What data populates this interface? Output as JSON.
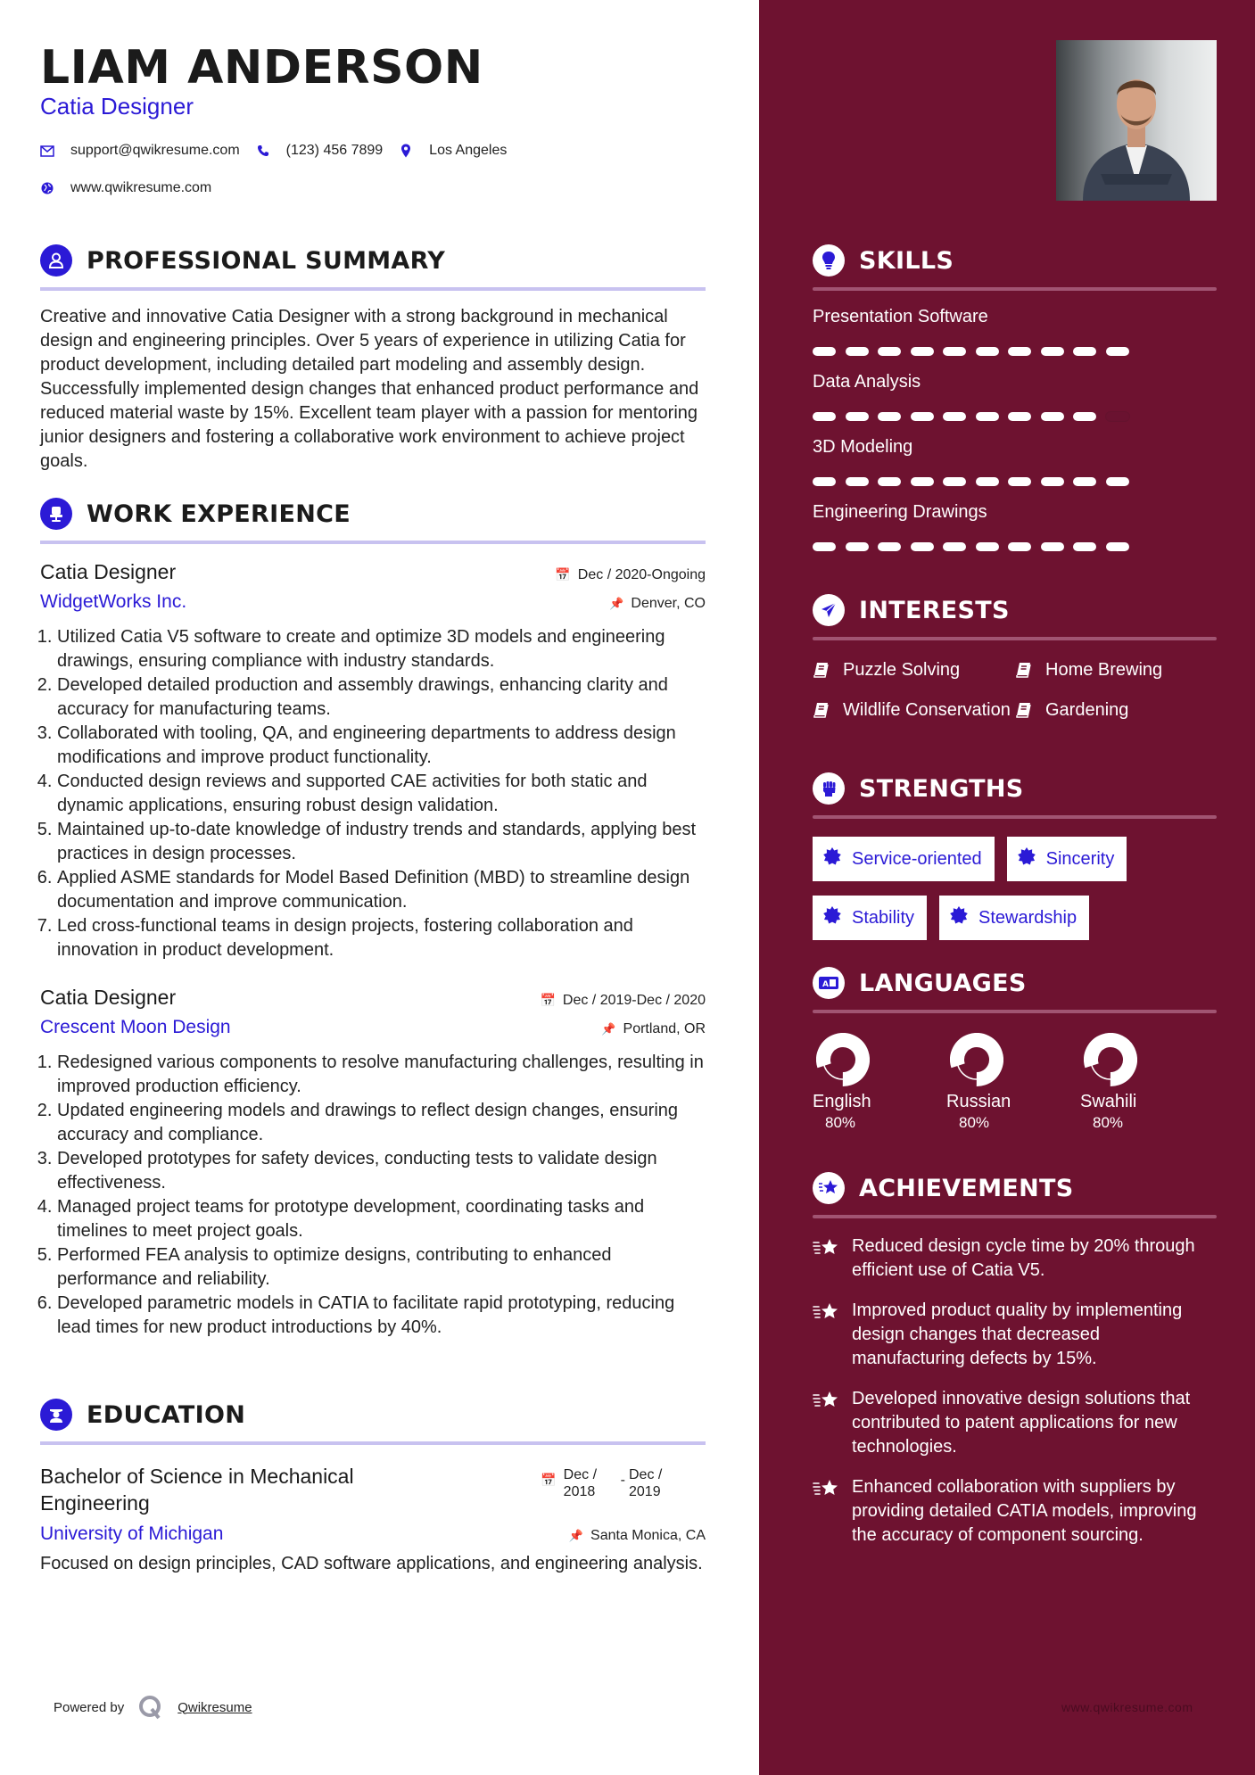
{
  "colors": {
    "accent": "#2b1ad6",
    "sidebar": "#6e1230",
    "rule": "#c8c2f0"
  },
  "header": {
    "name": "LIAM ANDERSON",
    "title": "Catia Designer",
    "email": "support@qwikresume.com",
    "phone": "(123) 456 7899",
    "location": "Los Angeles",
    "website": "www.qwikresume.com"
  },
  "summary": {
    "heading": "PROFESSIONAL SUMMARY",
    "text": "Creative and innovative Catia Designer with a strong background in mechanical design and engineering principles. Over 5 years of experience in utilizing Catia for product development, including detailed part modeling and assembly design. Successfully implemented design changes that enhanced product performance and reduced material waste by 15%. Excellent team player with a passion for mentoring junior designers and fostering a collaborative work environment to achieve project goals."
  },
  "experience": {
    "heading": "WORK EXPERIENCE",
    "jobs": [
      {
        "title": "Catia Designer",
        "dates": "Dec / 2020-Ongoing",
        "company": "WidgetWorks Inc.",
        "location": "Denver, CO",
        "bullets": [
          "Utilized Catia V5 software to create and optimize 3D models and engineering drawings, ensuring compliance with industry standards.",
          "Developed detailed production and assembly drawings, enhancing clarity and accuracy for manufacturing teams.",
          "Collaborated with tooling, QA, and engineering departments to address design modifications and improve product functionality.",
          "Conducted design reviews and supported CAE activities for both static and dynamic applications, ensuring robust design validation.",
          "Maintained up-to-date knowledge of industry trends and standards, applying best practices in design processes.",
          "Applied ASME standards for Model Based Definition (MBD) to streamline design documentation and improve communication.",
          "Led cross-functional teams in design projects, fostering collaboration and innovation in product development."
        ]
      },
      {
        "title": "Catia Designer",
        "dates": "Dec / 2019-Dec / 2020",
        "company": "Crescent Moon Design",
        "location": "Portland, OR",
        "bullets": [
          "Redesigned various components to resolve manufacturing challenges, resulting in improved production efficiency.",
          "Updated engineering models and drawings to reflect design changes, ensuring accuracy and compliance.",
          "Developed prototypes for safety devices, conducting tests to validate design effectiveness.",
          "Managed project teams for prototype development, coordinating tasks and timelines to meet project goals.",
          "Performed FEA analysis to optimize designs, contributing to enhanced performance and reliability.",
          "Developed parametric models in CATIA to facilitate rapid prototyping, reducing lead times for new product introductions by 40%."
        ]
      }
    ]
  },
  "education": {
    "heading": "EDUCATION",
    "degree": "Bachelor of Science in Mechanical Engineering",
    "start": "Dec / 2018",
    "end": "Dec / 2019",
    "school": "University of Michigan",
    "location": "Santa Monica, CA",
    "description": "Focused on design principles, CAD software applications, and engineering analysis."
  },
  "footer": {
    "powered_by": "Powered by",
    "brand": "Qwikresume",
    "watermark": "www.qwikresume.com"
  },
  "skills": {
    "heading": "SKILLS",
    "items": [
      {
        "name": "Presentation Software",
        "level": 10,
        "max": 10
      },
      {
        "name": "Data Analysis",
        "level": 9,
        "max": 10
      },
      {
        "name": "3D Modeling",
        "level": 10,
        "max": 10
      },
      {
        "name": "Engineering Drawings",
        "level": 10,
        "max": 10
      }
    ]
  },
  "interests": {
    "heading": "INTERESTS",
    "items": [
      "Puzzle Solving",
      "Home Brewing",
      "Wildlife Conservation",
      "Gardening"
    ]
  },
  "strengths": {
    "heading": "STRENGTHS",
    "items": [
      "Service-oriented",
      "Sincerity",
      "Stability",
      "Stewardship"
    ]
  },
  "languages": {
    "heading": "LANGUAGES",
    "items": [
      {
        "name": "English",
        "percent_label": "80%",
        "percent": 80
      },
      {
        "name": "Russian",
        "percent_label": "80%",
        "percent": 80
      },
      {
        "name": "Swahili",
        "percent_label": "80%",
        "percent": 80
      }
    ]
  },
  "achievements": {
    "heading": "ACHIEVEMENTS",
    "items": [
      "Reduced design cycle time by 20% through efficient use of Catia V5.",
      "Improved product quality by implementing design changes that decreased manufacturing defects by 15%.",
      "Developed innovative design solutions that contributed to patent applications for new technologies.",
      "Enhanced collaboration with suppliers by providing detailed CATIA models, improving the accuracy of component sourcing."
    ]
  }
}
